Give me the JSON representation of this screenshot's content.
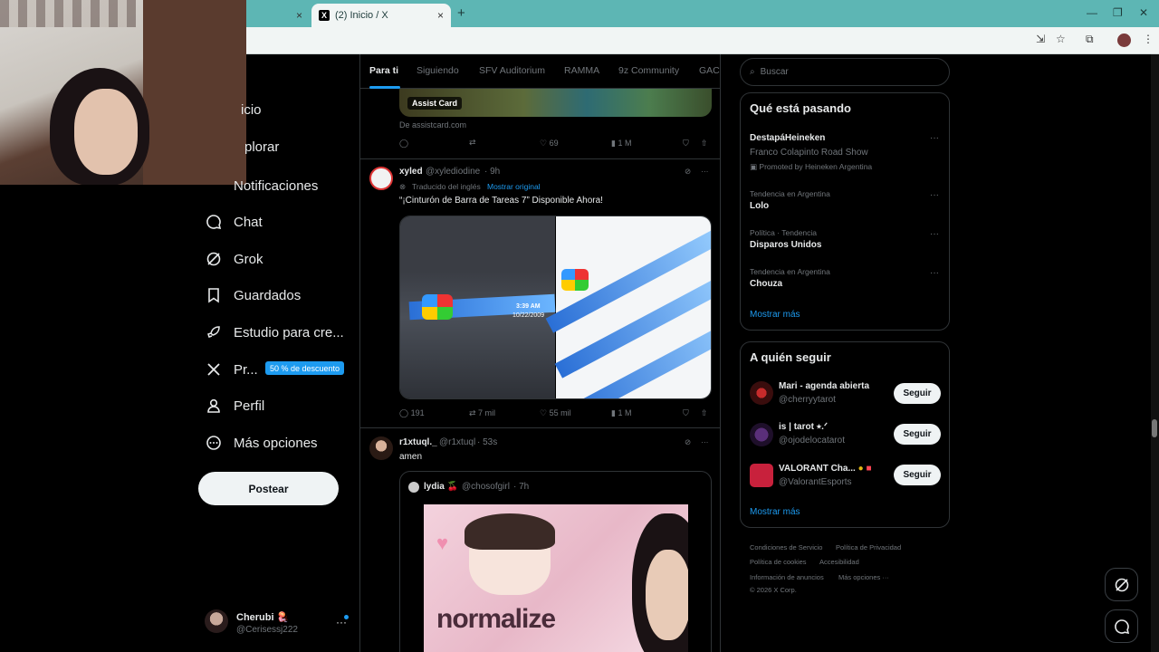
{
  "browser": {
    "tab_title": "(2) Inicio / X",
    "favicon": "X",
    "new_tab": "+",
    "close": "×"
  },
  "left_nav": {
    "items": [
      {
        "label": "icio",
        "icon": "home-icon"
      },
      {
        "label": "plorar",
        "icon": "search-icon"
      },
      {
        "label": "Notificaciones",
        "icon": "bell-icon"
      },
      {
        "label": "Chat",
        "icon": "chat-icon"
      },
      {
        "label": "Grok",
        "icon": "grok-icon"
      },
      {
        "label": "Guardados",
        "icon": "bookmark-icon"
      },
      {
        "label": "Estudio para cre...",
        "icon": "rocket-icon"
      },
      {
        "label": "Pr...",
        "icon": "x-logo-icon"
      },
      {
        "label": "Perfil",
        "icon": "person-icon"
      },
      {
        "label": "Más opciones",
        "icon": "more-circle-icon"
      }
    ],
    "premium_badge": "50 % de descuento",
    "post_button": "Postear",
    "account": {
      "name": "Cherubi 🪼",
      "handle": "@Cerisessj222",
      "more": "···"
    }
  },
  "feed": {
    "tabs": [
      "Para ti",
      "Siguiendo",
      "SFV Auditorium",
      "RAMMA",
      "9z Community",
      "GACI"
    ],
    "ad": {
      "badge": "Assist Card",
      "source": "De assistcard.com",
      "actions": {
        "replies": "",
        "reposts": "",
        "likes": "69",
        "views": "1 M"
      }
    },
    "tweet1": {
      "name": "xyled",
      "handle": "@xylediodine",
      "time": "· 9h",
      "translated": "Traducido del inglés",
      "show_original": "Mostrar original",
      "text": "“¡Cinturón de Barra de Tareas 7” Disponible Ahora!",
      "media_time": "3:39 AM",
      "media_date": "10/22/2009",
      "actions": {
        "replies": "191",
        "reposts": "7 mil",
        "likes": "55 mil",
        "views": "1 M"
      }
    },
    "tweet2": {
      "name": "r1xtuql._",
      "handle": "@r1xtuql",
      "time": "· 53s",
      "text": "amen",
      "quote": {
        "name": "lydia 🍒",
        "handle": "@chosofgirl",
        "time": "· 7h",
        "image_text": "normalize"
      }
    }
  },
  "right": {
    "search_placeholder": "Buscar",
    "trends": {
      "title": "Qué está pasando",
      "items": [
        {
          "meta": "",
          "name": "DestapáHeineken",
          "sub": "Franco Colapinto Road Show",
          "promo": "Promoted by Heineken Argentina"
        },
        {
          "meta": "Tendencia en Argentina",
          "name": "Lolo"
        },
        {
          "meta": "Política · Tendencia",
          "name": "Disparos Unidos"
        },
        {
          "meta": "Tendencia en Argentina",
          "name": "Chouza"
        }
      ],
      "show_more": "Mostrar más"
    },
    "who_to_follow": {
      "title": "A quién seguir",
      "items": [
        {
          "name": "Mari - agenda abierta",
          "handle": "@cherryytarot",
          "button": "Seguir"
        },
        {
          "name": "is | tarot ⭑.ᐟ",
          "handle": "@ojodelocatarot",
          "button": "Seguir"
        },
        {
          "name": "VALORANT Cha...",
          "handle": "@ValorantEsports",
          "button": "Seguir"
        }
      ],
      "show_more": "Mostrar más"
    },
    "footer": {
      "links": [
        "Condiciones de Servicio",
        "Política de Privacidad",
        "Política de cookies",
        "Accesibilidad",
        "Información de anuncios",
        "Más opciones ···"
      ],
      "copyright": "© 2026 X Corp."
    }
  },
  "colors": {
    "accent": "#1d9bf0",
    "background": "#000000",
    "border": "#2f3336",
    "tabbar": "#5db6b4"
  }
}
